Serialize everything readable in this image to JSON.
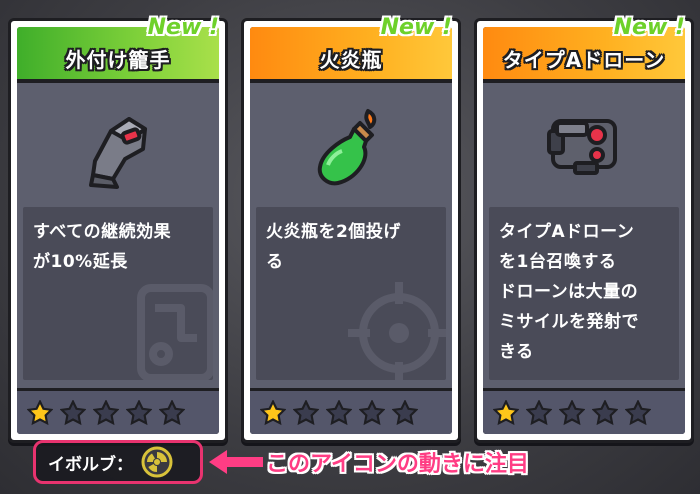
{
  "cards": [
    {
      "title": "外付け籠手",
      "new_label": "New !",
      "icon": "gauntlet-icon",
      "description": "すべての継続効果\nが10%延長",
      "rating": 1,
      "max_rating": 5
    },
    {
      "title": "火炎瓶",
      "new_label": "New !",
      "icon": "molotov-bottle-icon",
      "description": "火炎瓶を2個投げ\nる",
      "rating": 1,
      "max_rating": 5
    },
    {
      "title": "タイプAドローン",
      "new_label": "New !",
      "icon": "drone-icon",
      "description": "タイプAドローン\nを1台召喚する\nドローンは大量の\nミサイルを発射で\nきる",
      "rating": 1,
      "max_rating": 5
    }
  ],
  "evolve": {
    "label": "イボルブ：",
    "icon": "evolve-emblem-icon"
  },
  "annotation": "このアイコンの動きに注目",
  "colors": {
    "green_header": "#7fd13a",
    "orange_header": "#ffb020",
    "star_filled": "#ffc61a",
    "star_empty": "#3a3c4e",
    "highlight": "#e8336f"
  }
}
